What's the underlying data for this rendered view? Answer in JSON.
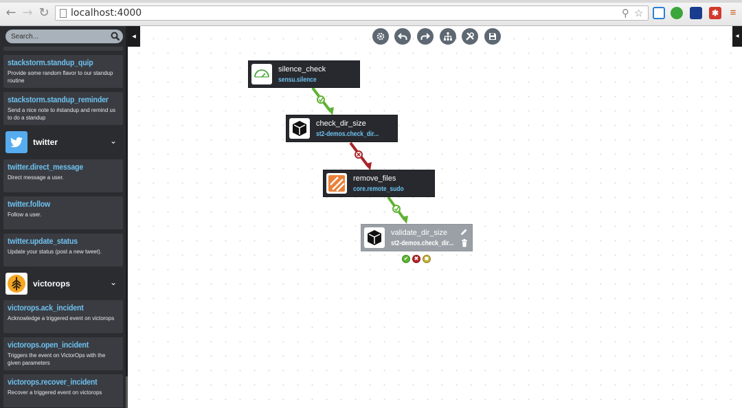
{
  "browser": {
    "url": "localhost:4000",
    "nav": {
      "back": "←",
      "forward": "→",
      "reload": "↻"
    }
  },
  "sidebar": {
    "search": {
      "placeholder": "Search..."
    },
    "collapse_glyph": "◂",
    "items": [
      {
        "name": "stackstorm.standup_quip",
        "description": "Provide some random flavor to our standup routine"
      },
      {
        "name": "stackstorm.standup_reminder",
        "description": "Send a nice note to #standup and remind us to do a standup"
      }
    ],
    "packs": [
      {
        "name": "twitter",
        "logo_color": "#55acee",
        "actions": [
          {
            "name": "twitter.direct_message",
            "description": "Direct message a user."
          },
          {
            "name": "twitter.follow",
            "description": "Follow a user."
          },
          {
            "name": "twitter.update_status",
            "description": "Update your status (post a new tweet)."
          }
        ]
      },
      {
        "name": "victorops",
        "logo_color": "#f5a623",
        "actions": [
          {
            "name": "victorops.ack_incident",
            "description": "Acknowledge a triggered event on victorops"
          },
          {
            "name": "victorops.open_incident",
            "description": "Triggers the event on VictorOps with the given parameters"
          },
          {
            "name": "victorops.recover_incident",
            "description": "Recover a triggered event on victorops"
          }
        ]
      }
    ]
  },
  "toolbar": {
    "buttons": [
      "settings-icon",
      "undo-icon",
      "redo-icon",
      "layout-icon",
      "tools-icon",
      "save-icon"
    ]
  },
  "workflow": {
    "nodes": [
      {
        "title": "silence_check",
        "ref": "sensu.silence",
        "icon": "gauge-icon",
        "selected": false
      },
      {
        "title": "check_dir_size",
        "ref": "st2-demos.check_dir...",
        "icon": "cube-icon",
        "selected": false
      },
      {
        "title": "remove_files",
        "ref": "core.remote_sudo",
        "icon": "core-icon",
        "selected": false
      },
      {
        "title": "validate_dir_size",
        "ref": "st2-demos.check_dir...",
        "icon": "cube-icon",
        "selected": true
      }
    ],
    "edges": [
      {
        "from": "silence_check",
        "to": "check_dir_size",
        "type": "success",
        "color": "#5fb233"
      },
      {
        "from": "check_dir_size",
        "to": "remove_files",
        "type": "failure",
        "color": "#a8252a"
      },
      {
        "from": "remove_files",
        "to": "validate_dir_size",
        "type": "success",
        "color": "#5fb233"
      }
    ],
    "ports": [
      {
        "type": "success",
        "color": "#5fb233",
        "glyph": "✔"
      },
      {
        "type": "failure",
        "color": "#b5272d",
        "glyph": "✖"
      },
      {
        "type": "complete",
        "color": "#c4b23a",
        "glyph": "■"
      }
    ]
  },
  "colors": {
    "sidebar_bg": "#2b2c30",
    "card_bg": "#3a3c42",
    "link": "#6ec1ee",
    "success": "#5fb233",
    "failure": "#a8252a"
  }
}
